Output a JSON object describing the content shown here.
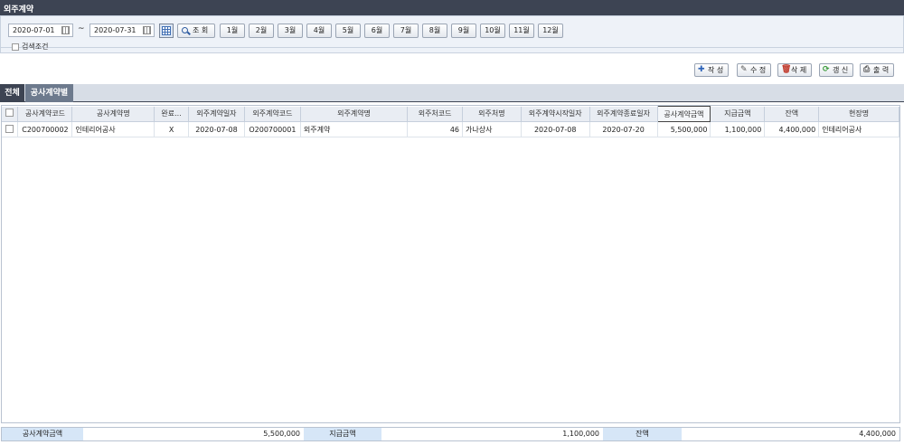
{
  "window": {
    "title": "외주계약"
  },
  "search": {
    "date_from": "2020-07-01",
    "separator": "~",
    "date_to": "2020-07-31",
    "search_label": "조 회",
    "months": [
      "1월",
      "2월",
      "3월",
      "4월",
      "5월",
      "6월",
      "7월",
      "8월",
      "9월",
      "10월",
      "11월",
      "12월"
    ],
    "condition_label": "검색조건"
  },
  "toolbar": {
    "create_label": "작 성",
    "edit_label": "수 정",
    "delete_label": "삭 제",
    "refresh_label": "갱 신",
    "print_label": "출 력"
  },
  "tabs": [
    {
      "label": "전체",
      "active": true
    },
    {
      "label": "공사계약별",
      "active": false
    }
  ],
  "table": {
    "headers": [
      "공사계약코드",
      "공사계약명",
      "완료...",
      "외주계약일자",
      "외주계약코드",
      "외주계약명",
      "외주처코드",
      "외주처명",
      "외주계약시작일자",
      "외주계약종료일자",
      "공사계약금액",
      "지급금액",
      "잔액",
      "현장명"
    ],
    "rows": [
      [
        "C200700002",
        "인테리어공사",
        "X",
        "2020-07-08",
        "O200700001",
        "외주계약",
        "46",
        "가나상사",
        "2020-07-08",
        "2020-07-20",
        "5,500,000",
        "1,100,000",
        "4,400,000",
        "인테리어공사"
      ]
    ]
  },
  "footer": {
    "contract_amount_label": "공사계약금액",
    "contract_amount_value": "5,500,000",
    "paid_label": "지급금액",
    "paid_value": "1,100,000",
    "balance_label": "잔액",
    "balance_value": "4,400,000"
  },
  "colors": {
    "titlebar": "#3d4453",
    "active_tab": "#3d4453",
    "footer_label": "#d6e6f7"
  }
}
